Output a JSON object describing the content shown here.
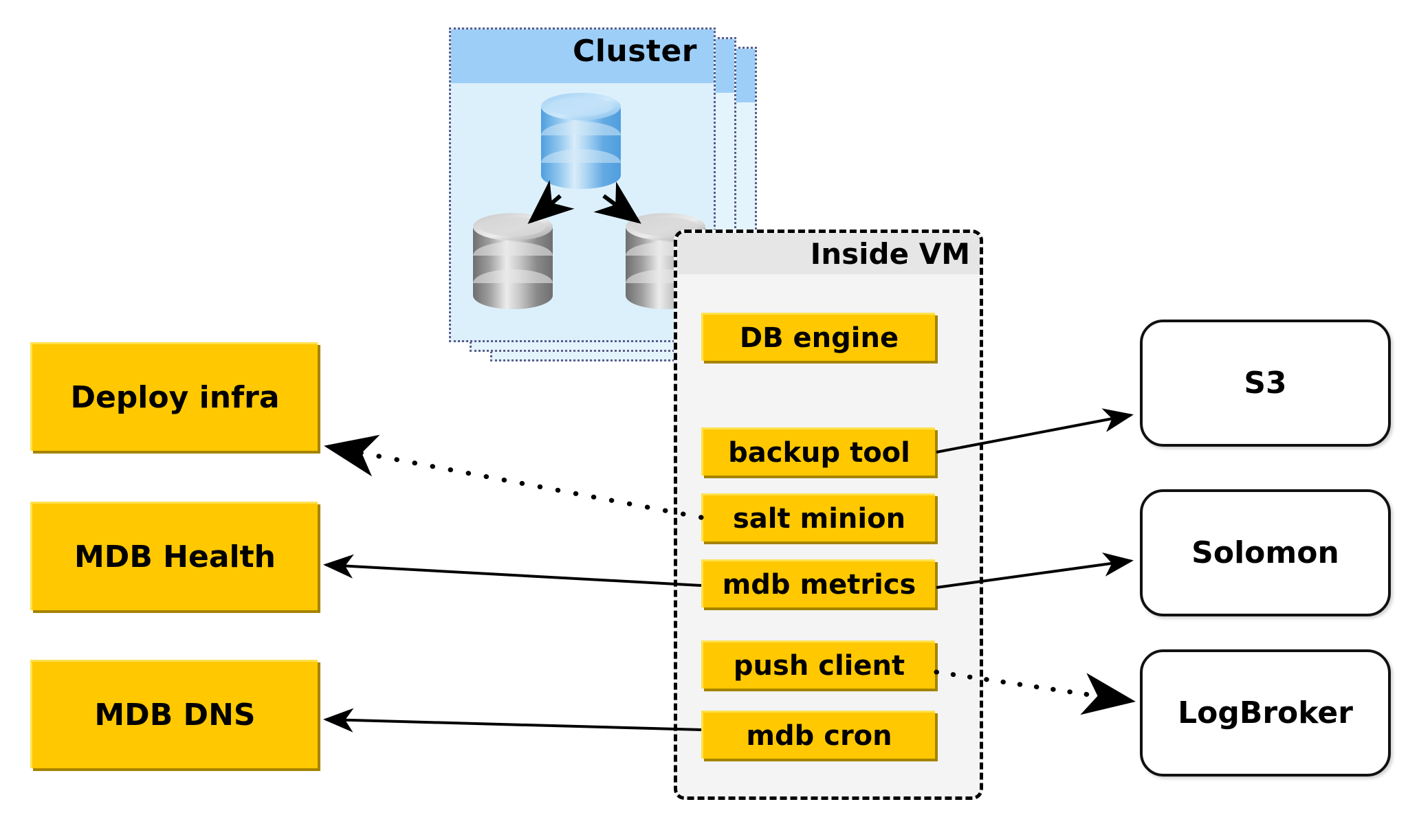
{
  "diagram": {
    "title_cluster": "Cluster",
    "title_vm": "Inside VM"
  },
  "cluster": {
    "label": "Cluster",
    "nodes": [
      {
        "name": "master-database",
        "type": "database-cylinder",
        "color": "#6aaee8",
        "role": "master"
      },
      {
        "name": "replica-database-left",
        "type": "database-cylinder",
        "color": "#b4b4b4",
        "role": "replica"
      },
      {
        "name": "replica-database-right",
        "type": "database-cylinder",
        "color": "#b4b4b4",
        "role": "replica"
      }
    ],
    "panel_count": 3,
    "header_color": "#9ccef8",
    "body_color": "#dcf0fc",
    "border_color": "#5b5b8a"
  },
  "vm": {
    "label": "Inside VM",
    "header_color": "#e6e6e6",
    "body_color": "#f4f4f4",
    "border_style": "dashed",
    "components": [
      {
        "label": "DB engine"
      },
      {
        "label": "backup tool"
      },
      {
        "label": "salt minion"
      },
      {
        "label": "mdb metrics"
      },
      {
        "label": "push client"
      },
      {
        "label": "mdb cron"
      }
    ]
  },
  "left_services": [
    {
      "label": "Deploy infra"
    },
    {
      "label": "MDB Health"
    },
    {
      "label": "MDB DNS"
    }
  ],
  "right_services": [
    {
      "label": "S3"
    },
    {
      "label": "Solomon"
    },
    {
      "label": "LogBroker"
    }
  ],
  "colors": {
    "yellow_box": "#FFC800",
    "yellow_shadow": "#a58300",
    "edge": "#000000"
  },
  "edges": [
    {
      "from": "salt minion",
      "to": "Deploy infra",
      "style": "dotted",
      "direction": "left"
    },
    {
      "from": "mdb metrics",
      "to": "MDB Health",
      "style": "solid",
      "direction": "left"
    },
    {
      "from": "mdb cron",
      "to": "MDB DNS",
      "style": "solid",
      "direction": "left"
    },
    {
      "from": "backup tool",
      "to": "S3",
      "style": "solid",
      "direction": "right"
    },
    {
      "from": "mdb metrics",
      "to": "Solomon",
      "style": "solid",
      "direction": "right"
    },
    {
      "from": "push client",
      "to": "LogBroker",
      "style": "dotted",
      "direction": "right"
    },
    {
      "from": "master-database",
      "to": "replica-database-left",
      "style": "solid",
      "direction": "down"
    },
    {
      "from": "master-database",
      "to": "replica-database-right",
      "style": "solid",
      "direction": "down"
    }
  ]
}
